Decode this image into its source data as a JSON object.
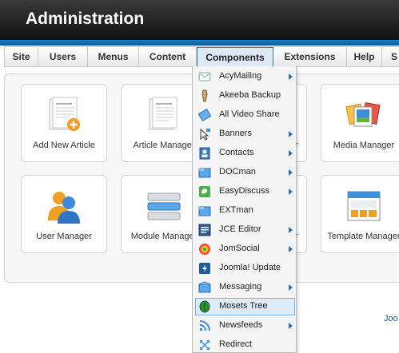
{
  "header": {
    "title": "Administration"
  },
  "menu": [
    {
      "label": "Site"
    },
    {
      "label": "Users"
    },
    {
      "label": "Menus"
    },
    {
      "label": "Content"
    },
    {
      "label": "Components"
    },
    {
      "label": "Extensions"
    },
    {
      "label": "Help"
    },
    {
      "label": "S"
    }
  ],
  "tiles": [
    {
      "label": "Add New Article",
      "icon": "add-article-icon"
    },
    {
      "label": "Article Manager",
      "icon": "article-manager-icon"
    },
    {
      "label": "r",
      "icon": "category-manager-icon"
    },
    {
      "label": "Media Manager",
      "icon": "media-manager-icon"
    },
    {
      "label": "User Manager",
      "icon": "user-manager-icon"
    },
    {
      "label": "Module Manager",
      "icon": "module-manager-icon"
    },
    {
      "label": "r",
      "icon": "plugin-manager-icon"
    },
    {
      "label": "Template Manager",
      "icon": "template-manager-icon"
    }
  ],
  "components_menu": [
    {
      "label": "AcyMailing",
      "submenu": true,
      "icon": "acymailing-icon"
    },
    {
      "label": "Akeeba Backup",
      "submenu": false,
      "icon": "akeeba-icon"
    },
    {
      "label": "All Video Share",
      "submenu": false,
      "icon": "video-share-icon"
    },
    {
      "label": "Banners",
      "submenu": true,
      "icon": "banners-icon"
    },
    {
      "label": "Contacts",
      "submenu": true,
      "icon": "contacts-icon"
    },
    {
      "label": "DOCman",
      "submenu": true,
      "icon": "docman-icon"
    },
    {
      "label": "EasyDiscuss",
      "submenu": true,
      "icon": "easydiscuss-icon"
    },
    {
      "label": "EXTman",
      "submenu": false,
      "icon": "extman-icon"
    },
    {
      "label": "JCE Editor",
      "submenu": true,
      "icon": "jce-editor-icon"
    },
    {
      "label": "JomSocial",
      "submenu": true,
      "icon": "jomsocial-icon"
    },
    {
      "label": "Joomla! Update",
      "submenu": false,
      "icon": "joomla-update-icon"
    },
    {
      "label": "Messaging",
      "submenu": true,
      "icon": "messaging-icon"
    },
    {
      "label": "Mosets Tree",
      "submenu": false,
      "icon": "mosets-tree-icon"
    },
    {
      "label": "Newsfeeds",
      "submenu": true,
      "icon": "newsfeeds-icon"
    },
    {
      "label": "Redirect",
      "submenu": false,
      "icon": "redirect-icon"
    }
  ],
  "footer": {
    "link_text": "Joo"
  },
  "colors": {
    "header_stripe": "#1e7fc0",
    "accent": "#2b78c4",
    "hover": "#dcecfa"
  }
}
